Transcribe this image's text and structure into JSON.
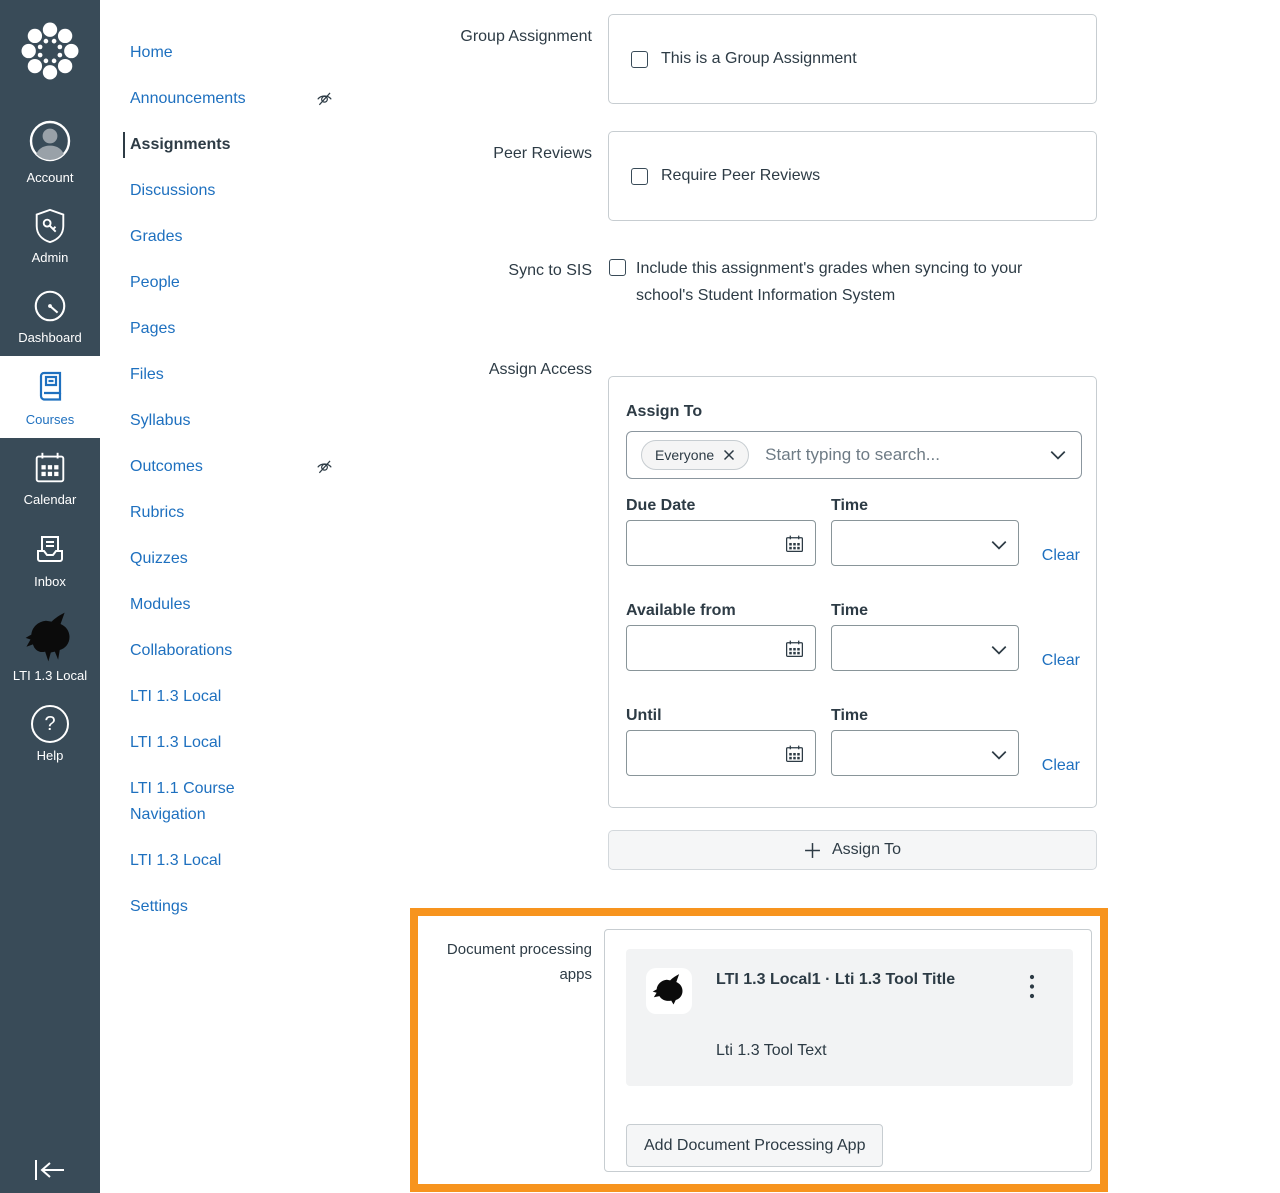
{
  "colors": {
    "sidebar_bg": "#394B58",
    "link_blue": "#1E70BF",
    "text_dark": "#2D3B45",
    "highlight_orange": "#F7941E"
  },
  "global_nav": {
    "items": [
      {
        "label": "Account"
      },
      {
        "label": "Admin"
      },
      {
        "label": "Dashboard"
      },
      {
        "label": "Courses",
        "active": true
      },
      {
        "label": "Calendar"
      },
      {
        "label": "Inbox"
      },
      {
        "label": "LTI 1.3 Local"
      },
      {
        "label": "Help"
      }
    ]
  },
  "course_nav": {
    "items": [
      {
        "label": "Home"
      },
      {
        "label": "Announcements",
        "hidden": true
      },
      {
        "label": "Assignments",
        "active": true
      },
      {
        "label": "Discussions"
      },
      {
        "label": "Grades"
      },
      {
        "label": "People"
      },
      {
        "label": "Pages"
      },
      {
        "label": "Files"
      },
      {
        "label": "Syllabus"
      },
      {
        "label": "Outcomes",
        "hidden": true
      },
      {
        "label": "Rubrics"
      },
      {
        "label": "Quizzes"
      },
      {
        "label": "Modules"
      },
      {
        "label": "Collaborations"
      },
      {
        "label": "LTI 1.3 Local"
      },
      {
        "label": "LTI 1.3 Local"
      },
      {
        "label": "LTI 1.1 Course Navigation"
      },
      {
        "label": "LTI 1.3 Local"
      },
      {
        "label": "Settings"
      }
    ]
  },
  "form": {
    "group_assignment": {
      "label": "Group Assignment",
      "checkbox_label": "This is a Group Assignment",
      "checked": false
    },
    "peer_reviews": {
      "label": "Peer Reviews",
      "checkbox_label": "Require Peer Reviews",
      "checked": false
    },
    "sync_to_sis": {
      "label": "Sync to SIS",
      "checkbox_label": "Include this assignment's grades when syncing to your school's Student Information System",
      "checked": false
    },
    "assign_access": {
      "label": "Assign Access",
      "assign_to_heading": "Assign To",
      "selected_tag": "Everyone",
      "search_placeholder": "Start typing to search...",
      "date_rows": [
        {
          "date_label": "Due Date",
          "time_label": "Time",
          "date_value": "",
          "time_value": "",
          "clear_label": "Clear"
        },
        {
          "date_label": "Available from",
          "time_label": "Time",
          "date_value": "",
          "time_value": "",
          "clear_label": "Clear"
        },
        {
          "date_label": "Until",
          "time_label": "Time",
          "date_value": "",
          "time_value": "",
          "clear_label": "Clear"
        }
      ],
      "assign_to_button": "Assign To"
    },
    "document_processing": {
      "label": "Document processing apps",
      "tool_title": "LTI 1.3 Local1 · Lti 1.3 Tool Title",
      "tool_description": "Lti 1.3 Tool Text",
      "add_button_label": "Add Document Processing App"
    }
  }
}
